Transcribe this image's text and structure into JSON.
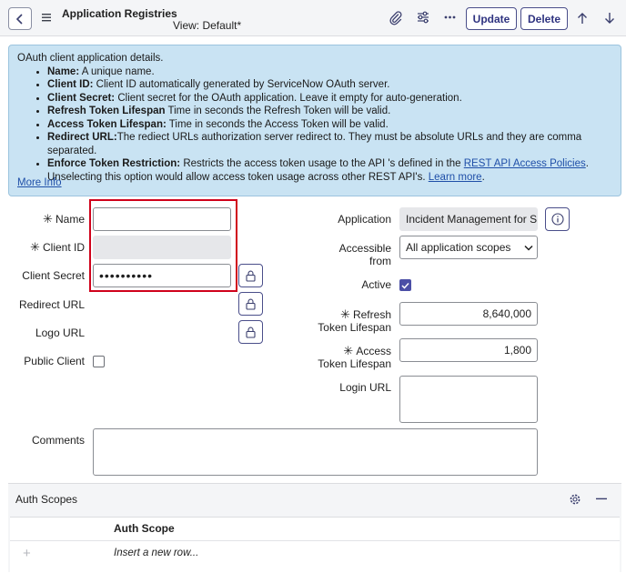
{
  "header": {
    "title": "Application Registries",
    "view": "View: Default*",
    "update_label": "Update",
    "delete_label": "Delete"
  },
  "info": {
    "intro": "OAuth client application details.",
    "items": [
      {
        "term": "Name:",
        "desc": " A unique name."
      },
      {
        "term": "Client ID:",
        "desc": " Client ID automatically generated by ServiceNow OAuth server."
      },
      {
        "term": "Client Secret:",
        "desc": " Client secret for the OAuth application. Leave it empty for auto-generation."
      },
      {
        "term": "Refresh Token Lifespan",
        "desc": " Time in seconds the Refresh Token will be valid."
      },
      {
        "term": "Access Token Lifespan:",
        "desc": " Time in seconds the Access Token will be valid."
      },
      {
        "term": "Redirect URL:",
        "desc": "The rediect URLs authorization server redirect to. They must be absolute URLs and they are comma separated."
      }
    ],
    "enforce_term": "Enforce Token Restriction:",
    "enforce_desc": " Restricts the access token usage to the API 's defined in the ",
    "enforce_link": "REST API Access Policies",
    "enforce_after": ".",
    "enforce_desc2": "Unselecting this option would allow access token usage across other REST API's. ",
    "learn_more": "Learn more",
    "learn_more_after": ".",
    "more_info": "More Info"
  },
  "form": {
    "required_mark": "✳",
    "name_label": "Name",
    "name_value": "",
    "client_id_label": "Client ID",
    "client_id_value": "",
    "client_secret_label": "Client Secret",
    "client_secret_value": "••••••••••",
    "redirect_url_label": "Redirect URL",
    "logo_url_label": "Logo URL",
    "public_client_label": "Public Client",
    "public_client_checked": false,
    "application_label": "Application",
    "application_value": "Incident Management for Se",
    "accessible_label_1": "Accessible",
    "accessible_label_2": "from",
    "accessible_value": "All application scopes",
    "active_label": "Active",
    "active_checked": true,
    "refresh_label_1": "Refresh",
    "refresh_label_2": "Token Lifespan",
    "refresh_value": "8,640,000",
    "access_label_1": "Access",
    "access_label_2": "Token Lifespan",
    "access_value": "1,800",
    "login_url_label": "Login URL",
    "comments_label": "Comments"
  },
  "auth_scopes": {
    "title": "Auth Scopes",
    "column": "Auth Scope",
    "insert_row": "Insert a new row...",
    "add_glyph": "+"
  },
  "colors": {
    "accent": "#4b4fa6",
    "button_text": "#2f3380",
    "info_bg": "#c9e3f3",
    "highlight_border": "#d0021b"
  },
  "icons": [
    "chevron-left-icon",
    "menu-icon",
    "paperclip-icon",
    "sliders-icon",
    "more-icon",
    "arrow-up-icon",
    "arrow-down-icon",
    "lock-icon",
    "info-icon",
    "gear-icon",
    "minus-icon",
    "plus-icon",
    "checkmark-icon"
  ]
}
